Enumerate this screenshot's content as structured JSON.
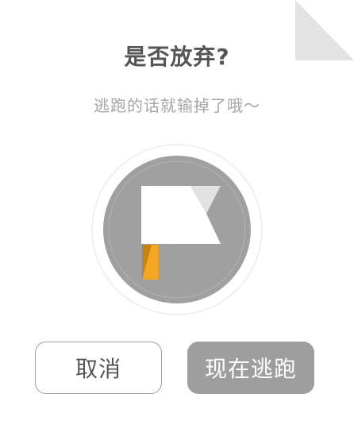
{
  "dialog": {
    "title": "是否放弃?",
    "message": "逃跑的话就输掉了哦～"
  },
  "icons": {
    "emblem": "white-flag-icon",
    "corner": "page-corner-fold"
  },
  "buttons": {
    "cancel_label": "取消",
    "confirm_label": "现在逃跑"
  },
  "colors": {
    "title": "#555555",
    "message": "#a6a6a6",
    "emblem_circle": "#a0a0a0",
    "flag": "#ffffff",
    "flag_pole": "#f5a623",
    "confirm_button": "#9e9e9e",
    "cancel_border": "#9e9e9e"
  }
}
